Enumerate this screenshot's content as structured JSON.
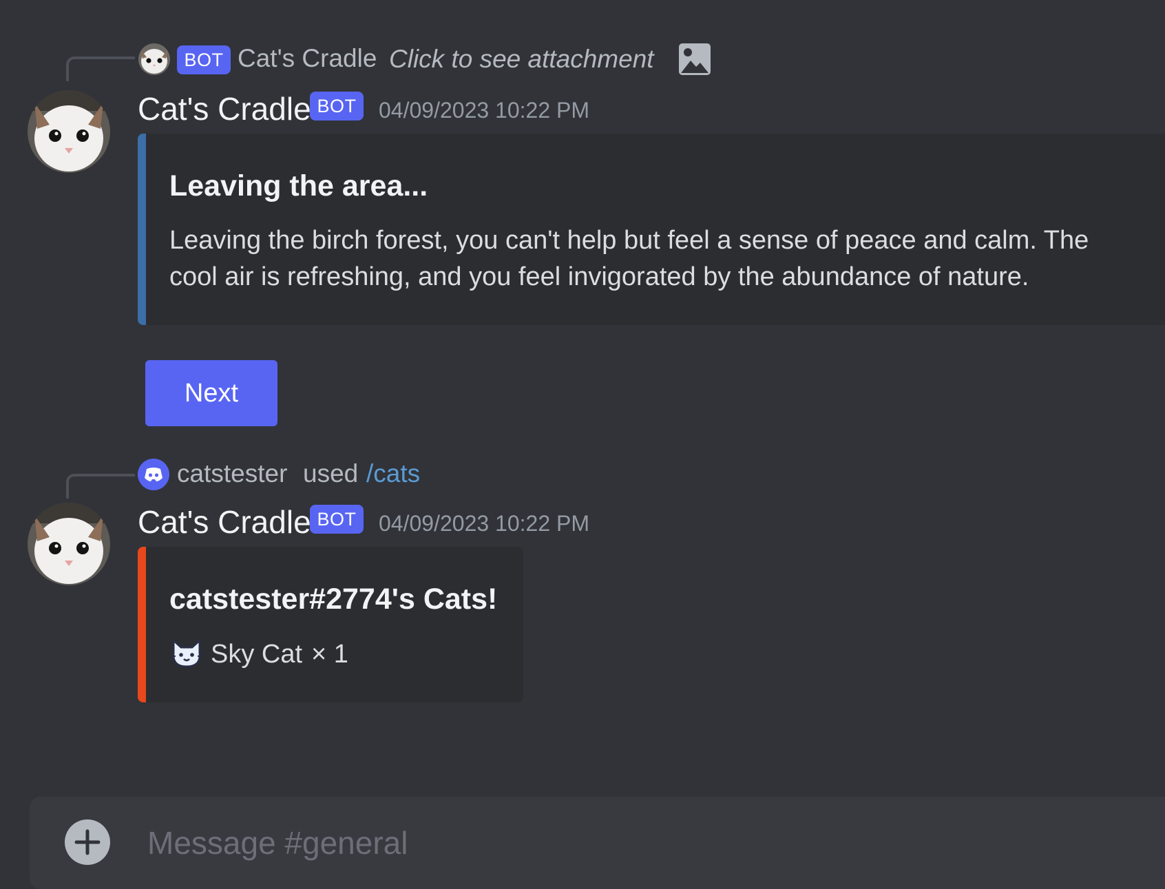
{
  "messages": [
    {
      "reply": {
        "author": "Cat's Cradle",
        "bot_tag": "BOT",
        "preview": "Click to see attachment",
        "icon": "image-icon"
      },
      "author": "Cat's Cradle",
      "bot_tag": "BOT",
      "timestamp": "04/09/2023 10:22 PM",
      "embed": {
        "accent_color": "#3c6ea8",
        "title": "Leaving the area...",
        "description": "Leaving the birch forest, you can't help but feel a sense of peace and calm. The cool air is refreshing, and you feel invigorated by the abundance of nature."
      },
      "button": {
        "label": "Next",
        "color": "#5865f2"
      }
    },
    {
      "interaction": {
        "user": "catstester",
        "verb": "used",
        "command": "/cats",
        "icon": "discord-icon"
      },
      "author": "Cat's Cradle",
      "bot_tag": "BOT",
      "timestamp": "04/09/2023 10:22 PM",
      "embed": {
        "accent_color": "#e8481c",
        "title": "catstester#2774's Cats!",
        "item_icon": "cat-face-icon",
        "item_name": "Sky Cat",
        "item_count": "× 1"
      }
    }
  ],
  "composer": {
    "placeholder": "Message #general",
    "add_icon": "plus-icon"
  }
}
